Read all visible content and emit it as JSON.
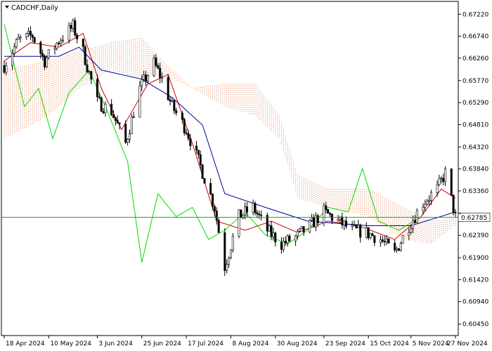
{
  "chart_data": {
    "type": "candlestick",
    "symbol_title": "CADCHF,Daily",
    "y_axis": {
      "min": 0.602,
      "max": 0.675,
      "ticks": [
        0.6722,
        0.6674,
        0.6626,
        0.6577,
        0.6529,
        0.6481,
        0.6432,
        0.6384,
        0.6336,
        0.6287,
        0.6239,
        0.619,
        0.6142,
        0.6094,
        0.6045
      ]
    },
    "x_axis": {
      "start": "2024-04-18",
      "end": "2024-11-27",
      "tick_labels": [
        {
          "date": "2024-04-18",
          "label": "18 Apr 2024"
        },
        {
          "date": "2024-05-10",
          "label": "10 May 2024"
        },
        {
          "date": "2024-06-03",
          "label": "3 Jun 2024"
        },
        {
          "date": "2024-06-25",
          "label": "25 Jun 2024"
        },
        {
          "date": "2024-07-17",
          "label": "17 Jul 2024"
        },
        {
          "date": "2024-08-08",
          "label": "8 Aug 2024"
        },
        {
          "date": "2024-08-30",
          "label": "30 Aug 2024"
        },
        {
          "date": "2024-09-23",
          "label": "23 Sep 2024"
        },
        {
          "date": "2024-10-15",
          "label": "15 Oct 2024"
        },
        {
          "date": "2024-11-05",
          "label": "5 Nov 2024"
        },
        {
          "date": "2024-11-27",
          "label": "27 Nov 2024"
        }
      ]
    },
    "current_price": {
      "value": 0.62785,
      "label": "0.62785",
      "color": "#00a000"
    },
    "close_path": [
      {
        "date": "2024-04-18",
        "value": 0.661
      },
      {
        "date": "2024-04-25",
        "value": 0.6665
      },
      {
        "date": "2024-05-02",
        "value": 0.6675
      },
      {
        "date": "2024-05-08",
        "value": 0.662
      },
      {
        "date": "2024-05-15",
        "value": 0.6665
      },
      {
        "date": "2024-05-22",
        "value": 0.6695
      },
      {
        "date": "2024-05-27",
        "value": 0.664
      },
      {
        "date": "2024-06-03",
        "value": 0.653
      },
      {
        "date": "2024-06-10",
        "value": 0.651
      },
      {
        "date": "2024-06-17",
        "value": 0.644
      },
      {
        "date": "2024-06-24",
        "value": 0.656
      },
      {
        "date": "2024-07-01",
        "value": 0.6615
      },
      {
        "date": "2024-07-05",
        "value": 0.658
      },
      {
        "date": "2024-07-10",
        "value": 0.652
      },
      {
        "date": "2024-07-17",
        "value": 0.647
      },
      {
        "date": "2024-07-24",
        "value": 0.639
      },
      {
        "date": "2024-07-31",
        "value": 0.63
      },
      {
        "date": "2024-08-05",
        "value": 0.617
      },
      {
        "date": "2024-08-12",
        "value": 0.628
      },
      {
        "date": "2024-08-19",
        "value": 0.63
      },
      {
        "date": "2024-08-26",
        "value": 0.625
      },
      {
        "date": "2024-09-02",
        "value": 0.622
      },
      {
        "date": "2024-09-09",
        "value": 0.6235
      },
      {
        "date": "2024-09-16",
        "value": 0.626
      },
      {
        "date": "2024-09-23",
        "value": 0.629
      },
      {
        "date": "2024-09-30",
        "value": 0.627
      },
      {
        "date": "2024-10-07",
        "value": 0.625
      },
      {
        "date": "2024-10-14",
        "value": 0.6245
      },
      {
        "date": "2024-10-21",
        "value": 0.623
      },
      {
        "date": "2024-10-28",
        "value": 0.62
      },
      {
        "date": "2024-11-04",
        "value": 0.626
      },
      {
        "date": "2024-11-11",
        "value": 0.631
      },
      {
        "date": "2024-11-18",
        "value": 0.634
      },
      {
        "date": "2024-11-22",
        "value": 0.6375
      },
      {
        "date": "2024-11-27",
        "value": 0.6279
      }
    ],
    "series": [
      {
        "color": "#cc0000",
        "values": [
          {
            "date": "2024-04-18",
            "value": 0.662
          },
          {
            "date": "2024-05-01",
            "value": 0.666
          },
          {
            "date": "2024-05-15",
            "value": 0.665
          },
          {
            "date": "2024-05-27",
            "value": 0.668
          },
          {
            "date": "2024-06-05",
            "value": 0.656
          },
          {
            "date": "2024-06-15",
            "value": 0.647
          },
          {
            "date": "2024-06-28",
            "value": 0.657
          },
          {
            "date": "2024-07-08",
            "value": 0.659
          },
          {
            "date": "2024-07-20",
            "value": 0.644
          },
          {
            "date": "2024-08-01",
            "value": 0.627
          },
          {
            "date": "2024-08-15",
            "value": 0.625
          },
          {
            "date": "2024-08-28",
            "value": 0.627
          },
          {
            "date": "2024-09-10",
            "value": 0.6245
          },
          {
            "date": "2024-09-25",
            "value": 0.627
          },
          {
            "date": "2024-10-10",
            "value": 0.626
          },
          {
            "date": "2024-10-28",
            "value": 0.623
          },
          {
            "date": "2024-11-10",
            "value": 0.628
          },
          {
            "date": "2024-11-20",
            "value": 0.634
          },
          {
            "date": "2024-11-27",
            "value": 0.632
          }
        ]
      },
      {
        "color": "#000099",
        "values": [
          {
            "date": "2024-04-18",
            "value": 0.663
          },
          {
            "date": "2024-05-15",
            "value": 0.663
          },
          {
            "date": "2024-05-25",
            "value": 0.665
          },
          {
            "date": "2024-06-05",
            "value": 0.66
          },
          {
            "date": "2024-06-25",
            "value": 0.658
          },
          {
            "date": "2024-07-10",
            "value": 0.654
          },
          {
            "date": "2024-07-25",
            "value": 0.648
          },
          {
            "date": "2024-08-05",
            "value": 0.633
          },
          {
            "date": "2024-08-25",
            "value": 0.63
          },
          {
            "date": "2024-09-15",
            "value": 0.627
          },
          {
            "date": "2024-10-15",
            "value": 0.626
          },
          {
            "date": "2024-11-05",
            "value": 0.626
          },
          {
            "date": "2024-11-27",
            "value": 0.629
          }
        ]
      },
      {
        "color": "#00dd00",
        "values": [
          {
            "date": "2024-04-18",
            "value": 0.67
          },
          {
            "date": "2024-04-28",
            "value": 0.652
          },
          {
            "date": "2024-05-05",
            "value": 0.656
          },
          {
            "date": "2024-05-12",
            "value": 0.645
          },
          {
            "date": "2024-05-20",
            "value": 0.655
          },
          {
            "date": "2024-05-30",
            "value": 0.66
          },
          {
            "date": "2024-06-08",
            "value": 0.651
          },
          {
            "date": "2024-06-18",
            "value": 0.64
          },
          {
            "date": "2024-06-25",
            "value": 0.618
          },
          {
            "date": "2024-07-03",
            "value": 0.633
          },
          {
            "date": "2024-07-12",
            "value": 0.628
          },
          {
            "date": "2024-07-20",
            "value": 0.63
          },
          {
            "date": "2024-07-28",
            "value": 0.623
          },
          {
            "date": "2024-08-05",
            "value": 0.625
          },
          {
            "date": "2024-08-15",
            "value": 0.629
          },
          {
            "date": "2024-08-25",
            "value": 0.624
          },
          {
            "date": "2024-09-05",
            "value": 0.622
          },
          {
            "date": "2024-09-15",
            "value": 0.625
          },
          {
            "date": "2024-09-25",
            "value": 0.63
          },
          {
            "date": "2024-10-05",
            "value": 0.629
          },
          {
            "date": "2024-10-12",
            "value": 0.6385
          },
          {
            "date": "2024-10-20",
            "value": 0.627
          },
          {
            "date": "2024-10-30",
            "value": 0.625
          },
          {
            "date": "2024-11-10",
            "value": 0.628
          }
        ]
      }
    ],
    "cloud": {
      "colors": {
        "bullish": "#e08050",
        "bearish": "#9999bb"
      },
      "span_a": [
        {
          "date": "2024-04-18",
          "value": 0.66
        },
        {
          "date": "2024-05-10",
          "value": 0.662
        },
        {
          "date": "2024-05-25",
          "value": 0.664
        },
        {
          "date": "2024-06-10",
          "value": 0.666
        },
        {
          "date": "2024-06-25",
          "value": 0.667
        },
        {
          "date": "2024-07-05",
          "value": 0.662
        },
        {
          "date": "2024-07-20",
          "value": 0.656
        },
        {
          "date": "2024-08-05",
          "value": 0.657
        },
        {
          "date": "2024-08-20",
          "value": 0.657
        },
        {
          "date": "2024-09-01",
          "value": 0.65
        },
        {
          "date": "2024-09-10",
          "value": 0.637
        },
        {
          "date": "2024-09-25",
          "value": 0.634
        },
        {
          "date": "2024-10-15",
          "value": 0.634
        },
        {
          "date": "2024-11-01",
          "value": 0.63
        },
        {
          "date": "2024-11-15",
          "value": 0.627
        },
        {
          "date": "2024-11-27",
          "value": 0.6275
        }
      ],
      "span_b": [
        {
          "date": "2024-04-18",
          "value": 0.645
        },
        {
          "date": "2024-05-10",
          "value": 0.65
        },
        {
          "date": "2024-05-25",
          "value": 0.656
        },
        {
          "date": "2024-06-10",
          "value": 0.66
        },
        {
          "date": "2024-06-25",
          "value": 0.658
        },
        {
          "date": "2024-07-05",
          "value": 0.659
        },
        {
          "date": "2024-07-20",
          "value": 0.656
        },
        {
          "date": "2024-08-05",
          "value": 0.652
        },
        {
          "date": "2024-08-20",
          "value": 0.65
        },
        {
          "date": "2024-09-01",
          "value": 0.645
        },
        {
          "date": "2024-09-10",
          "value": 0.632
        },
        {
          "date": "2024-09-25",
          "value": 0.63
        },
        {
          "date": "2024-10-15",
          "value": 0.628
        },
        {
          "date": "2024-11-01",
          "value": 0.623
        },
        {
          "date": "2024-11-15",
          "value": 0.622
        },
        {
          "date": "2024-11-27",
          "value": 0.626
        }
      ]
    },
    "grid": false,
    "legend": "none"
  }
}
